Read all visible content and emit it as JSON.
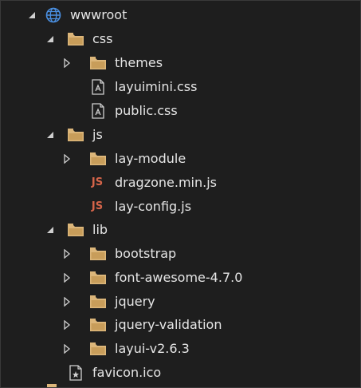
{
  "tree": {
    "root": {
      "label": "wwwroot",
      "icon": "globe-icon",
      "expanded": true
    },
    "css": {
      "label": "css",
      "icon": "folder-icon",
      "expanded": true,
      "themes": {
        "label": "themes",
        "icon": "folder-icon",
        "expanded": false
      },
      "layuimini": {
        "label": "layuimini.css",
        "icon": "css-file-icon"
      },
      "public": {
        "label": "public.css",
        "icon": "css-file-icon"
      }
    },
    "js": {
      "label": "js",
      "icon": "folder-icon",
      "expanded": true,
      "lay_module": {
        "label": "lay-module",
        "icon": "folder-icon",
        "expanded": false
      },
      "dragzone": {
        "label": "dragzone.min.js",
        "icon": "js-file-icon",
        "badge": "JS"
      },
      "lay_config": {
        "label": "lay-config.js",
        "icon": "js-file-icon",
        "badge": "JS"
      }
    },
    "lib": {
      "label": "lib",
      "icon": "folder-icon",
      "expanded": true,
      "bootstrap": {
        "label": "bootstrap",
        "icon": "folder-icon",
        "expanded": false
      },
      "font_awesome": {
        "label": "font-awesome-4.7.0",
        "icon": "folder-icon",
        "expanded": false
      },
      "jquery": {
        "label": "jquery",
        "icon": "folder-icon",
        "expanded": false
      },
      "jquery_validation": {
        "label": "jquery-validation",
        "icon": "folder-icon",
        "expanded": false
      },
      "layui": {
        "label": "layui-v2.6.3",
        "icon": "folder-icon",
        "expanded": false
      }
    },
    "favicon": {
      "label": "favicon.ico",
      "icon": "image-file-icon"
    }
  },
  "colors": {
    "background": "#1e1e1e",
    "folder": "#dcb67a",
    "js_badge": "#d6654a",
    "globe": "#4a8fe0",
    "text": "#e6e6e6",
    "chevron": "#cfcfcf"
  }
}
